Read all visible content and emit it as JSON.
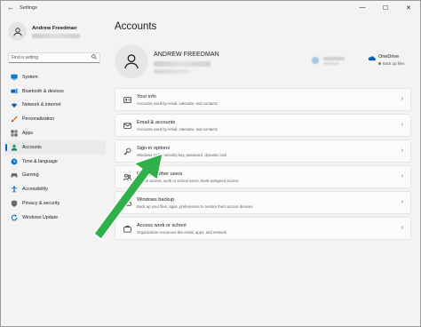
{
  "window": {
    "title": "Settings",
    "back_glyph": "←",
    "minimize_glyph": "—",
    "maximize_glyph": "☐",
    "close_glyph": "✕"
  },
  "sidebar": {
    "profile_name": "Andrew Freedman",
    "search_placeholder": "Find a setting",
    "items": [
      {
        "label": "System",
        "icon": "monitor-icon",
        "color": "#0078d4"
      },
      {
        "label": "Bluetooth & devices",
        "icon": "bluetooth-icon",
        "color": "#0067c0"
      },
      {
        "label": "Network & internet",
        "icon": "wifi-icon",
        "color": "#1a5fb4"
      },
      {
        "label": "Personalization",
        "icon": "brush-icon",
        "color": "#e05a00"
      },
      {
        "label": "Apps",
        "icon": "apps-icon",
        "color": "#5c6770"
      },
      {
        "label": "Accounts",
        "icon": "person-icon",
        "color": "#2aa56b",
        "active": true
      },
      {
        "label": "Time & language",
        "icon": "globe-clock-icon",
        "color": "#0078d4"
      },
      {
        "label": "Gaming",
        "icon": "gamepad-icon",
        "color": "#6b6b6b"
      },
      {
        "label": "Accessibility",
        "icon": "accessibility-icon",
        "color": "#1f6fc1"
      },
      {
        "label": "Privacy & security",
        "icon": "shield-icon",
        "color": "#6b6b6b"
      },
      {
        "label": "Windows Update",
        "icon": "update-icon",
        "color": "#0078d4"
      }
    ]
  },
  "main": {
    "page_title": "Accounts",
    "account_name": "ANDREW FREEDMAN",
    "onedrive": {
      "title": "OneDrive",
      "subtitle": "Back up files",
      "color": "#0364b8"
    },
    "cards": [
      {
        "title": "Your info",
        "subtitle": "Accounts used by email, calendar, and contacts",
        "icon": "person-card-icon"
      },
      {
        "title": "Email & accounts",
        "subtitle": "Accounts used by email, calendar, and contacts",
        "icon": "mail-icon"
      },
      {
        "title": "Sign-in options",
        "subtitle": "Windows Hello, security key, password, dynamic lock",
        "icon": "key-icon"
      },
      {
        "title": "Family & other users",
        "subtitle": "Device access, work or school users, kiosk assigned access",
        "icon": "family-icon"
      },
      {
        "title": "Windows backup",
        "subtitle": "Back up your files, apps, preferences to restore them across devices",
        "icon": "backup-icon"
      },
      {
        "title": "Access work or school",
        "subtitle": "Organization resources like email, apps, and network",
        "icon": "briefcase-icon"
      }
    ],
    "chevron_glyph": "›"
  },
  "annotation": {
    "arrow_color": "#2fb14a"
  }
}
